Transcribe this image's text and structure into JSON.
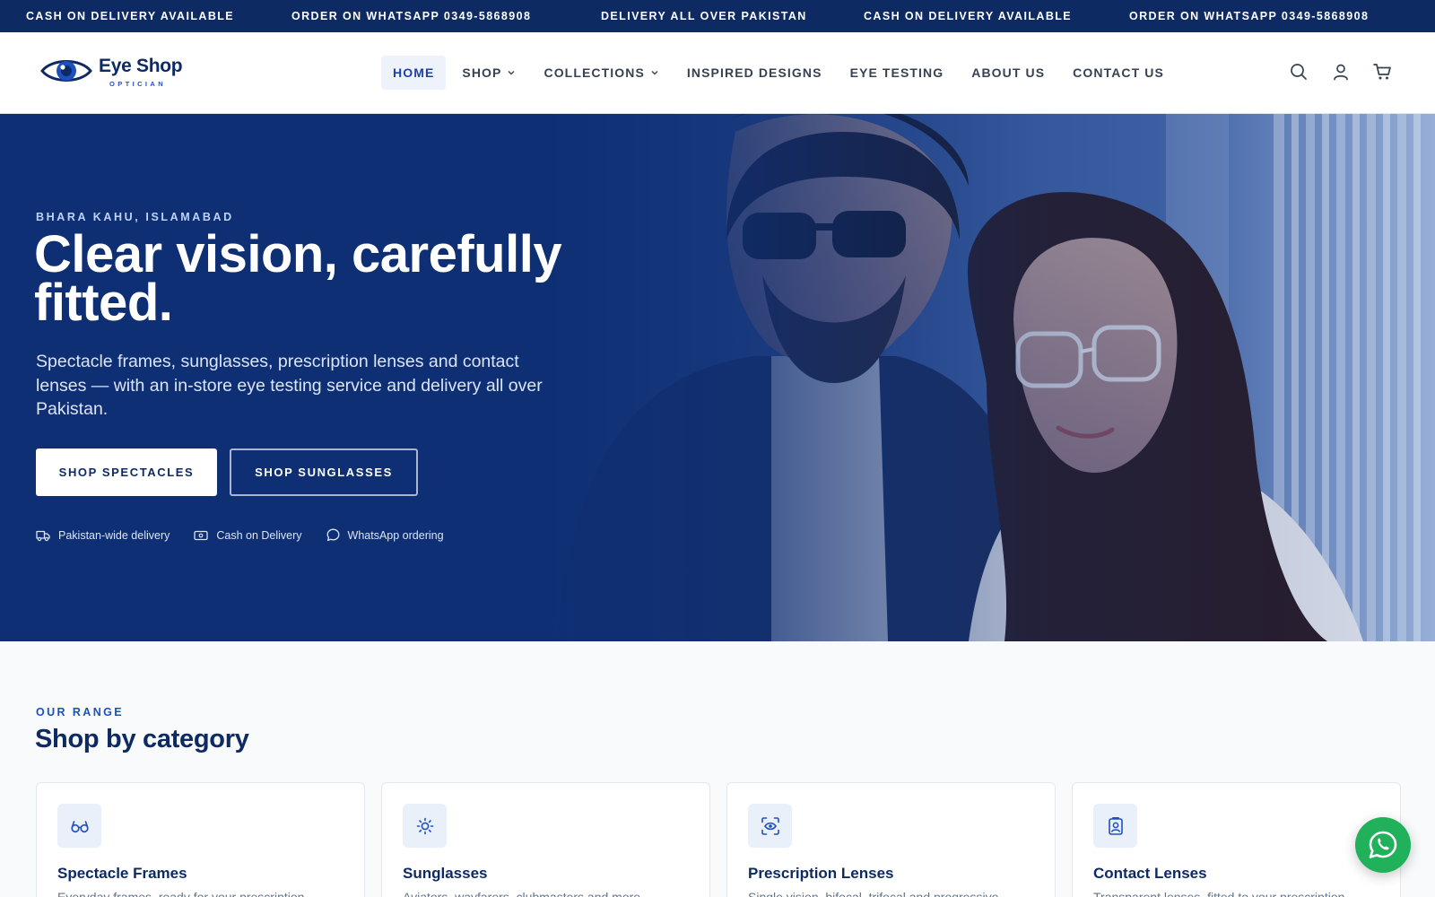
{
  "announcement_bar": {
    "items": [
      "CASH ON DELIVERY AVAILABLE",
      "ORDER ON WHATSAPP 0349-5868908",
      "DELIVERY ALL OVER PAKISTAN",
      "CASH ON DELIVERY AVAILABLE",
      "ORDER ON WHATSAPP 0349-5868908"
    ]
  },
  "header": {
    "logo_name": "Eye Shop",
    "logo_sub": "OPTICIAN",
    "nav": [
      {
        "label": "HOME",
        "active": true
      },
      {
        "label": "SHOP",
        "dropdown": true
      },
      {
        "label": "COLLECTIONS",
        "dropdown": true
      },
      {
        "label": "INSPIRED DESIGNS"
      },
      {
        "label": "EYE TESTING"
      },
      {
        "label": "ABOUT US"
      },
      {
        "label": "CONTACT US"
      }
    ],
    "icons": [
      "search-icon",
      "account-icon",
      "cart-icon"
    ]
  },
  "hero": {
    "eyebrow": "BHARA KAHU, ISLAMABAD",
    "title": "Clear vision, carefully fitted.",
    "text": "Spectacle frames, sunglasses, prescription lenses and contact lenses — with an in-store eye testing service and delivery all over Pakistan.",
    "primary_button": "SHOP SPECTACLES",
    "secondary_button": "SHOP SUNGLASSES",
    "perks": [
      {
        "icon": "truck-icon",
        "label": "Pakistan-wide delivery"
      },
      {
        "icon": "cash-icon",
        "label": "Cash on Delivery"
      },
      {
        "icon": "chat-icon",
        "label": "WhatsApp ordering"
      }
    ]
  },
  "categories": {
    "eyebrow": "OUR RANGE",
    "title": "Shop by category",
    "items": [
      {
        "icon": "glasses-icon",
        "title": "Spectacle Frames",
        "desc": "Everyday frames, ready for your prescription."
      },
      {
        "icon": "sun-icon",
        "title": "Sunglasses",
        "desc": "Aviators, wayfarers, clubmasters and more."
      },
      {
        "icon": "eye-scan-icon",
        "title": "Prescription Lenses",
        "desc": "Single vision, bifocal, trifocal and progressive."
      },
      {
        "icon": "contact-lens-icon",
        "title": "Contact Lenses",
        "desc": "Transparent lenses, fitted to your prescription."
      }
    ]
  },
  "floating": {
    "icon": "whatsapp-icon"
  },
  "colors": {
    "navy": "#0d2a63",
    "hero_blue": "#0f2f74",
    "accent_blue": "#1e40af",
    "whatsapp_green": "#21b15a"
  }
}
